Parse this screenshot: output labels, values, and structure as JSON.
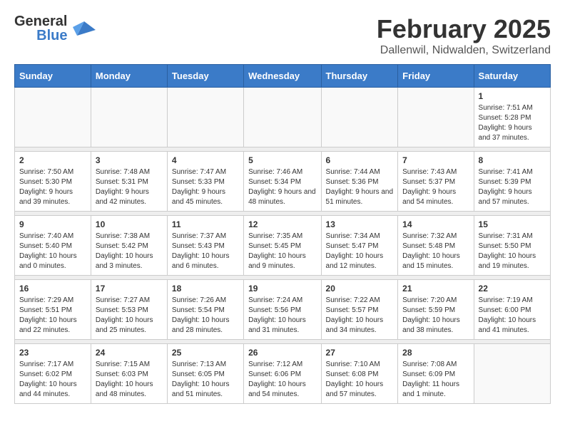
{
  "header": {
    "logo_general": "General",
    "logo_blue": "Blue",
    "month_year": "February 2025",
    "location": "Dallenwil, Nidwalden, Switzerland"
  },
  "days_of_week": [
    "Sunday",
    "Monday",
    "Tuesday",
    "Wednesday",
    "Thursday",
    "Friday",
    "Saturday"
  ],
  "weeks": [
    [
      {
        "day": "",
        "info": ""
      },
      {
        "day": "",
        "info": ""
      },
      {
        "day": "",
        "info": ""
      },
      {
        "day": "",
        "info": ""
      },
      {
        "day": "",
        "info": ""
      },
      {
        "day": "",
        "info": ""
      },
      {
        "day": "1",
        "info": "Sunrise: 7:51 AM\nSunset: 5:28 PM\nDaylight: 9 hours and 37 minutes."
      }
    ],
    [
      {
        "day": "2",
        "info": "Sunrise: 7:50 AM\nSunset: 5:30 PM\nDaylight: 9 hours and 39 minutes."
      },
      {
        "day": "3",
        "info": "Sunrise: 7:48 AM\nSunset: 5:31 PM\nDaylight: 9 hours and 42 minutes."
      },
      {
        "day": "4",
        "info": "Sunrise: 7:47 AM\nSunset: 5:33 PM\nDaylight: 9 hours and 45 minutes."
      },
      {
        "day": "5",
        "info": "Sunrise: 7:46 AM\nSunset: 5:34 PM\nDaylight: 9 hours and 48 minutes."
      },
      {
        "day": "6",
        "info": "Sunrise: 7:44 AM\nSunset: 5:36 PM\nDaylight: 9 hours and 51 minutes."
      },
      {
        "day": "7",
        "info": "Sunrise: 7:43 AM\nSunset: 5:37 PM\nDaylight: 9 hours and 54 minutes."
      },
      {
        "day": "8",
        "info": "Sunrise: 7:41 AM\nSunset: 5:39 PM\nDaylight: 9 hours and 57 minutes."
      }
    ],
    [
      {
        "day": "9",
        "info": "Sunrise: 7:40 AM\nSunset: 5:40 PM\nDaylight: 10 hours and 0 minutes."
      },
      {
        "day": "10",
        "info": "Sunrise: 7:38 AM\nSunset: 5:42 PM\nDaylight: 10 hours and 3 minutes."
      },
      {
        "day": "11",
        "info": "Sunrise: 7:37 AM\nSunset: 5:43 PM\nDaylight: 10 hours and 6 minutes."
      },
      {
        "day": "12",
        "info": "Sunrise: 7:35 AM\nSunset: 5:45 PM\nDaylight: 10 hours and 9 minutes."
      },
      {
        "day": "13",
        "info": "Sunrise: 7:34 AM\nSunset: 5:47 PM\nDaylight: 10 hours and 12 minutes."
      },
      {
        "day": "14",
        "info": "Sunrise: 7:32 AM\nSunset: 5:48 PM\nDaylight: 10 hours and 15 minutes."
      },
      {
        "day": "15",
        "info": "Sunrise: 7:31 AM\nSunset: 5:50 PM\nDaylight: 10 hours and 19 minutes."
      }
    ],
    [
      {
        "day": "16",
        "info": "Sunrise: 7:29 AM\nSunset: 5:51 PM\nDaylight: 10 hours and 22 minutes."
      },
      {
        "day": "17",
        "info": "Sunrise: 7:27 AM\nSunset: 5:53 PM\nDaylight: 10 hours and 25 minutes."
      },
      {
        "day": "18",
        "info": "Sunrise: 7:26 AM\nSunset: 5:54 PM\nDaylight: 10 hours and 28 minutes."
      },
      {
        "day": "19",
        "info": "Sunrise: 7:24 AM\nSunset: 5:56 PM\nDaylight: 10 hours and 31 minutes."
      },
      {
        "day": "20",
        "info": "Sunrise: 7:22 AM\nSunset: 5:57 PM\nDaylight: 10 hours and 34 minutes."
      },
      {
        "day": "21",
        "info": "Sunrise: 7:20 AM\nSunset: 5:59 PM\nDaylight: 10 hours and 38 minutes."
      },
      {
        "day": "22",
        "info": "Sunrise: 7:19 AM\nSunset: 6:00 PM\nDaylight: 10 hours and 41 minutes."
      }
    ],
    [
      {
        "day": "23",
        "info": "Sunrise: 7:17 AM\nSunset: 6:02 PM\nDaylight: 10 hours and 44 minutes."
      },
      {
        "day": "24",
        "info": "Sunrise: 7:15 AM\nSunset: 6:03 PM\nDaylight: 10 hours and 48 minutes."
      },
      {
        "day": "25",
        "info": "Sunrise: 7:13 AM\nSunset: 6:05 PM\nDaylight: 10 hours and 51 minutes."
      },
      {
        "day": "26",
        "info": "Sunrise: 7:12 AM\nSunset: 6:06 PM\nDaylight: 10 hours and 54 minutes."
      },
      {
        "day": "27",
        "info": "Sunrise: 7:10 AM\nSunset: 6:08 PM\nDaylight: 10 hours and 57 minutes."
      },
      {
        "day": "28",
        "info": "Sunrise: 7:08 AM\nSunset: 6:09 PM\nDaylight: 11 hours and 1 minute."
      },
      {
        "day": "",
        "info": ""
      }
    ]
  ]
}
